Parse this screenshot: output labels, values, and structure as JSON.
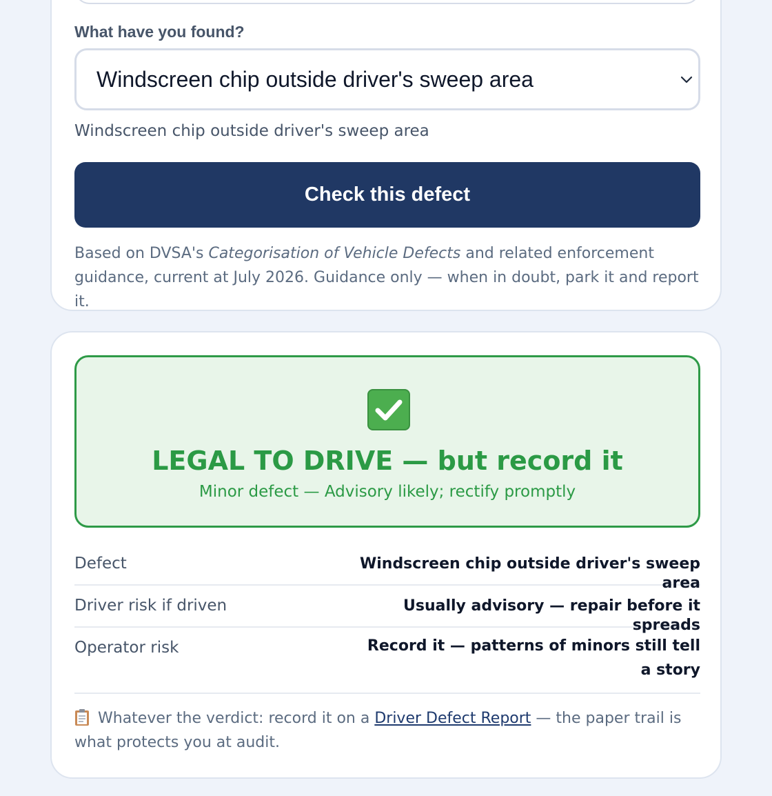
{
  "form": {
    "field_label": "What have you found?",
    "selected_option": "Windscreen chip outside driver's sweep area",
    "helper_text": "Windscreen chip outside driver's sweep area",
    "submit_label": "Check this defect",
    "source_prefix": "Based on DVSA's ",
    "source_title": "Categorisation of Vehicle Defects",
    "source_suffix": " and related enforcement guidance, current at July 2026. Guidance only — when in doubt, park it and report it."
  },
  "result": {
    "verdict_icon": "check-mark-button-icon",
    "verdict_title": "LEGAL TO DRIVE — but record it",
    "verdict_subtitle": "Minor defect — Advisory likely; rectify promptly",
    "rows": [
      {
        "label": "Defect",
        "value": "Windscreen chip outside driver's sweep area"
      },
      {
        "label": "Driver risk if driven",
        "value": "Usually advisory — repair before it spreads"
      },
      {
        "label": "Operator risk",
        "value": "Record it — patterns of minors still tell a story"
      }
    ],
    "footnote_icon": "clipboard-icon",
    "footnote_prefix": "Whatever the verdict: record it on a ",
    "footnote_link": "Driver Defect Report",
    "footnote_suffix": " — the paper trail is what protects you at audit."
  },
  "colors": {
    "page_bg": "#eff3fa",
    "button_bg": "#203864",
    "verdict_green": "#2b9a45",
    "verdict_bg": "#e8f5e9"
  }
}
